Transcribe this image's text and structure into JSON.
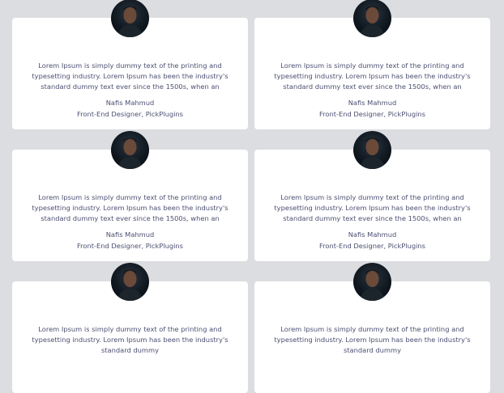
{
  "cards": [
    {
      "text": "Lorem Ipsum is simply dummy text of the printing and typesetting industry. Lorem Ipsum has been the industry's standard dummy text ever since the 1500s, when an",
      "name": "Nafis Mahmud",
      "role": "Front-End Designer, PickPlugins"
    },
    {
      "text": "Lorem Ipsum is simply dummy text of the printing and typesetting industry. Lorem Ipsum has been the industry's standard dummy text ever since the 1500s, when an",
      "name": "Nafis Mahmud",
      "role": "Front-End Designer, PickPlugins"
    },
    {
      "text": "Lorem Ipsum is simply dummy text of the printing and typesetting industry. Lorem Ipsum has been the industry's standard dummy text ever since the 1500s, when an",
      "name": "Nafis Mahmud",
      "role": "Front-End Designer, PickPlugins"
    },
    {
      "text": "Lorem Ipsum is simply dummy text of the printing and typesetting industry. Lorem Ipsum has been the industry's standard dummy text ever since the 1500s, when an",
      "name": "Nafis Mahmud",
      "role": "Front-End Designer, PickPlugins"
    },
    {
      "text": "Lorem Ipsum is simply dummy text of the printing and typesetting industry. Lorem Ipsum has been the industry's standard dummy",
      "name": "",
      "role": ""
    },
    {
      "text": "Lorem Ipsum is simply dummy text of the printing and typesetting industry. Lorem Ipsum has been the industry's standard dummy",
      "name": "",
      "role": ""
    }
  ]
}
